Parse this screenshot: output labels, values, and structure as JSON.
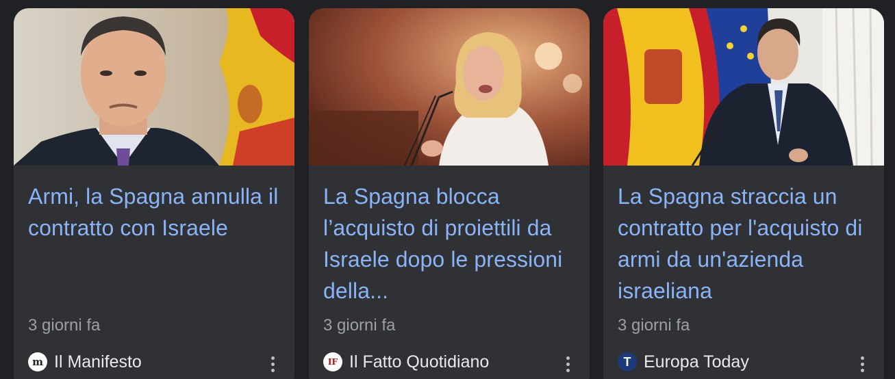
{
  "cards": [
    {
      "image_alt": "Pedro Sánchez davanti alla bandiera spagnola",
      "headline": "Armi, la Spagna annulla il contratto con Israele",
      "time": "3 giorni fa",
      "source": "Il Manifesto",
      "logo_icon": "il-manifesto-logo-icon",
      "logo_text": "m"
    },
    {
      "image_alt": "Yolanda Díaz parla in Parlamento",
      "headline": "La Spagna blocca l’acquisto di proiettili da Israele dopo le pressioni della...",
      "time": "3 giorni fa",
      "source": "Il Fatto Quotidiano",
      "logo_icon": "il-fatto-quotidiano-logo-icon",
      "logo_text": "IF"
    },
    {
      "image_alt": "Pedro Sánchez con le bandiere di Spagna e Unione Europea",
      "headline": "La Spagna straccia un contratto per l'acquisto di armi da un'azienda israeliana",
      "time": "3 giorni fa",
      "source": "Europa Today",
      "logo_icon": "europa-today-logo-icon",
      "logo_text": "T"
    }
  ],
  "colors": {
    "background": "#202124",
    "card": "#303134",
    "headline": "#8ab4f8",
    "meta": "#9aa0a6",
    "source": "#e8eaed"
  }
}
